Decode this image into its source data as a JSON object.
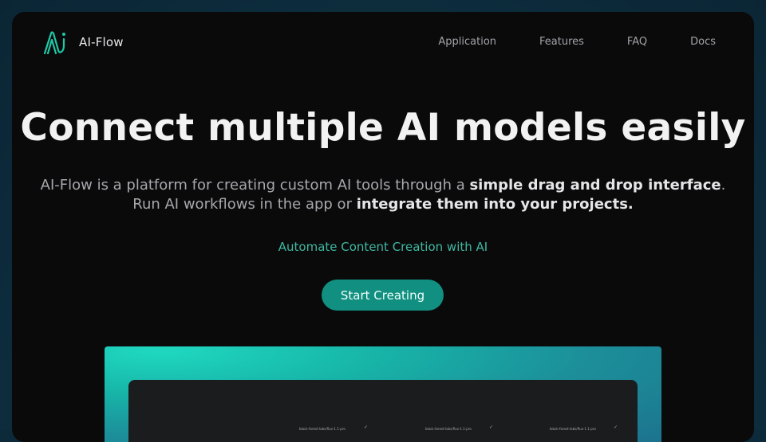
{
  "brand": {
    "name": "AI-Flow",
    "logo_icon": "ai-flow-logo-icon",
    "accent": "#1ec9a8"
  },
  "nav": {
    "links": [
      {
        "label": "Application"
      },
      {
        "label": "Features"
      },
      {
        "label": "FAQ"
      },
      {
        "label": "Docs"
      }
    ]
  },
  "hero": {
    "title": "Connect multiple AI models easily",
    "description": {
      "part1": "AI-Flow is a platform for creating custom AI tools through a ",
      "bold1": "simple drag and drop interface",
      "part2": ".",
      "part3": "Run AI workflows in the app or ",
      "bold2": "integrate them into your projects."
    },
    "tagline": "Automate Content Creation with AI",
    "cta_label": "Start Creating"
  },
  "preview": {
    "nodes": [
      {
        "label": "black-forest-labs/flux-1.1-pro"
      },
      {
        "label": "black-forest-labs/flux-1.1-pro"
      },
      {
        "label": "black-forest-labs/flux-1.1-pro"
      }
    ],
    "check_icon": "check-icon"
  },
  "colors": {
    "background": "#0a0a0b",
    "cta": "#118f80",
    "tagline": "#3fb7a0"
  }
}
